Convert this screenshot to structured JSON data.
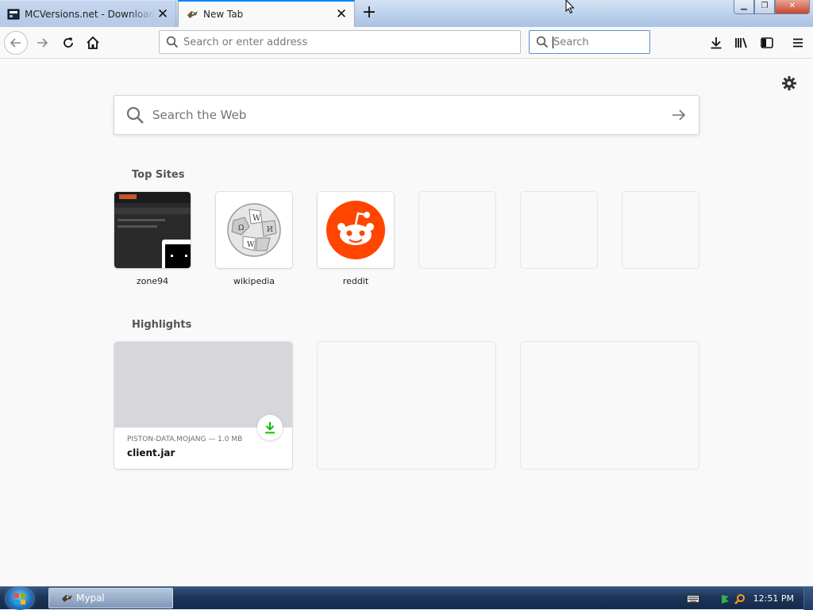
{
  "tabs": [
    {
      "title": "MCVersions.net - Download Minecraft Versions Easily",
      "active": false
    },
    {
      "title": "New Tab",
      "active": true
    }
  ],
  "window": {
    "minimize": "▁",
    "restore": "❐",
    "close": "✕"
  },
  "toolbar": {
    "url_placeholder": "Search or enter address",
    "search_placeholder": "Search"
  },
  "newtab": {
    "web_search_placeholder": "Search the Web",
    "top_sites_heading": "Top Sites",
    "top_sites": [
      {
        "label": "zone94",
        "icon": "zone94-thumbnail"
      },
      {
        "label": "wikipedia",
        "icon": "wikipedia-globe-icon"
      },
      {
        "label": "reddit",
        "icon": "reddit-icon"
      },
      {
        "label": "",
        "icon": "empty"
      },
      {
        "label": "",
        "icon": "empty"
      },
      {
        "label": "",
        "icon": "empty"
      }
    ],
    "highlights_heading": "Highlights",
    "highlights": [
      {
        "meta": "PISTON-DATA.MOJANG — 1.0 MB",
        "name": "client.jar",
        "icon": "download-icon"
      }
    ]
  },
  "taskbar": {
    "app_label": "Mypal",
    "clock": "12:51 PM"
  },
  "colors": {
    "accent": "#0a84ff",
    "reddit": "#ff4500",
    "download_green": "#12bc00"
  }
}
